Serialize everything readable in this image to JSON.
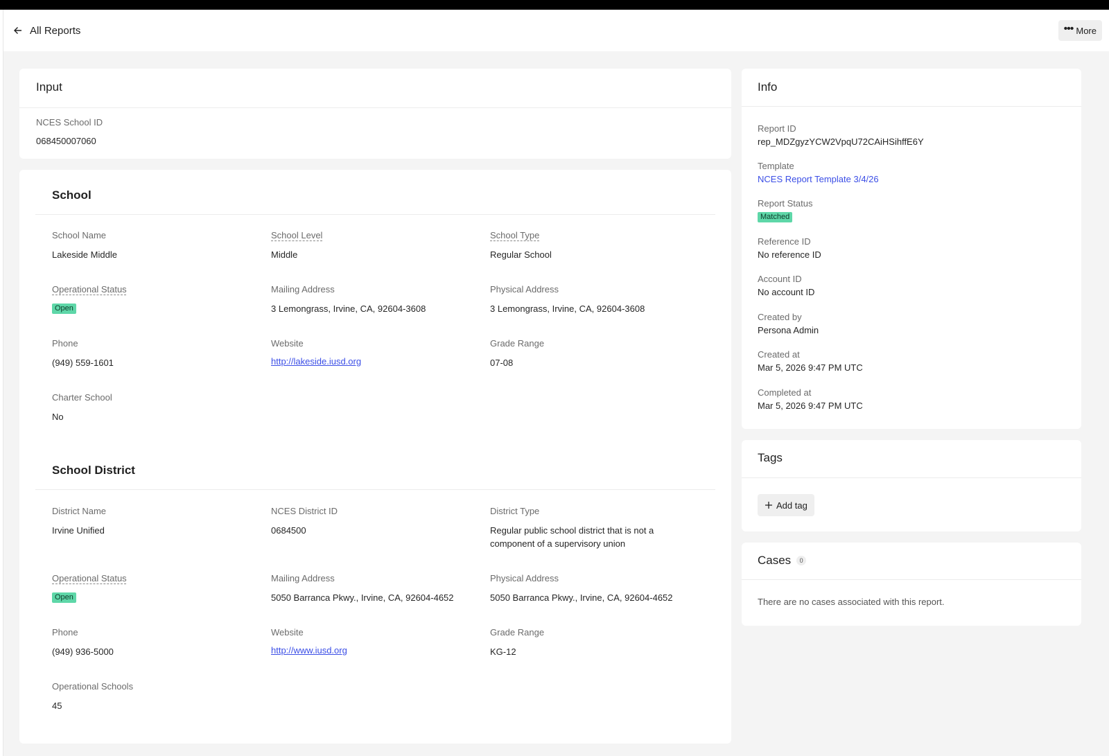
{
  "header": {
    "back_label": "All Reports",
    "more_label": "More"
  },
  "input": {
    "title": "Input",
    "fields": [
      {
        "label": "NCES School ID",
        "value": "068450007060"
      }
    ]
  },
  "school": {
    "title": "School",
    "fields": [
      {
        "label": "School Name",
        "value": "Lakeside Middle"
      },
      {
        "label": "School Level",
        "value": "Middle"
      },
      {
        "label": "School Type",
        "value": "Regular School"
      },
      {
        "label": "Operational Status",
        "value": "Open"
      },
      {
        "label": "Mailing Address",
        "value": "3 Lemongrass, Irvine, CA, 92604-3608"
      },
      {
        "label": "Physical Address",
        "value": "3 Lemongrass, Irvine, CA, 92604-3608"
      },
      {
        "label": "Phone",
        "value": "(949) 559-1601"
      },
      {
        "label": "Website",
        "value": "http://lakeside.iusd.org"
      },
      {
        "label": "Grade Range",
        "value": "07-08"
      },
      {
        "label": "Charter School",
        "value": "No"
      }
    ]
  },
  "district": {
    "title": "School District",
    "fields": [
      {
        "label": "District Name",
        "value": "Irvine Unified"
      },
      {
        "label": "NCES District ID",
        "value": "0684500"
      },
      {
        "label": "District Type",
        "value": "Regular public school district that is not a component of a supervisory union"
      },
      {
        "label": "Operational Status",
        "value": "Open"
      },
      {
        "label": "Mailing Address",
        "value": "5050 Barranca Pkwy., Irvine, CA, 92604-4652"
      },
      {
        "label": "Physical Address",
        "value": "5050 Barranca Pkwy., Irvine, CA, 92604-4652"
      },
      {
        "label": "Phone",
        "value": "(949) 936-5000"
      },
      {
        "label": "Website",
        "value": "http://www.iusd.org"
      },
      {
        "label": "Grade Range",
        "value": "KG-12"
      },
      {
        "label": "Operational Schools",
        "value": "45"
      }
    ]
  },
  "info": {
    "title": "Info",
    "rows": [
      {
        "label": "Report ID",
        "value": "rep_MDZgyzYCW2VpqU72CAiHSihffE6Y"
      },
      {
        "label": "Template",
        "value": "NCES Report Template 3/4/26"
      },
      {
        "label": "Report Status",
        "value": "Matched"
      },
      {
        "label": "Reference ID",
        "value": "No reference ID"
      },
      {
        "label": "Account ID",
        "value": "No account ID"
      },
      {
        "label": "Created by",
        "value": "Persona Admin"
      },
      {
        "label": "Created at",
        "value": "Mar 5, 2026 9:47 PM UTC"
      },
      {
        "label": "Completed at",
        "value": "Mar 5, 2026 9:47 PM UTC"
      }
    ]
  },
  "tags": {
    "title": "Tags",
    "add_label": "Add tag"
  },
  "cases": {
    "title": "Cases",
    "count": "0",
    "empty_text": "There are no cases associated with this report."
  },
  "colors": {
    "link": "#3b4ee6",
    "badge_bg": "#5ed7a8",
    "page_bg": "#f4f4f4"
  }
}
